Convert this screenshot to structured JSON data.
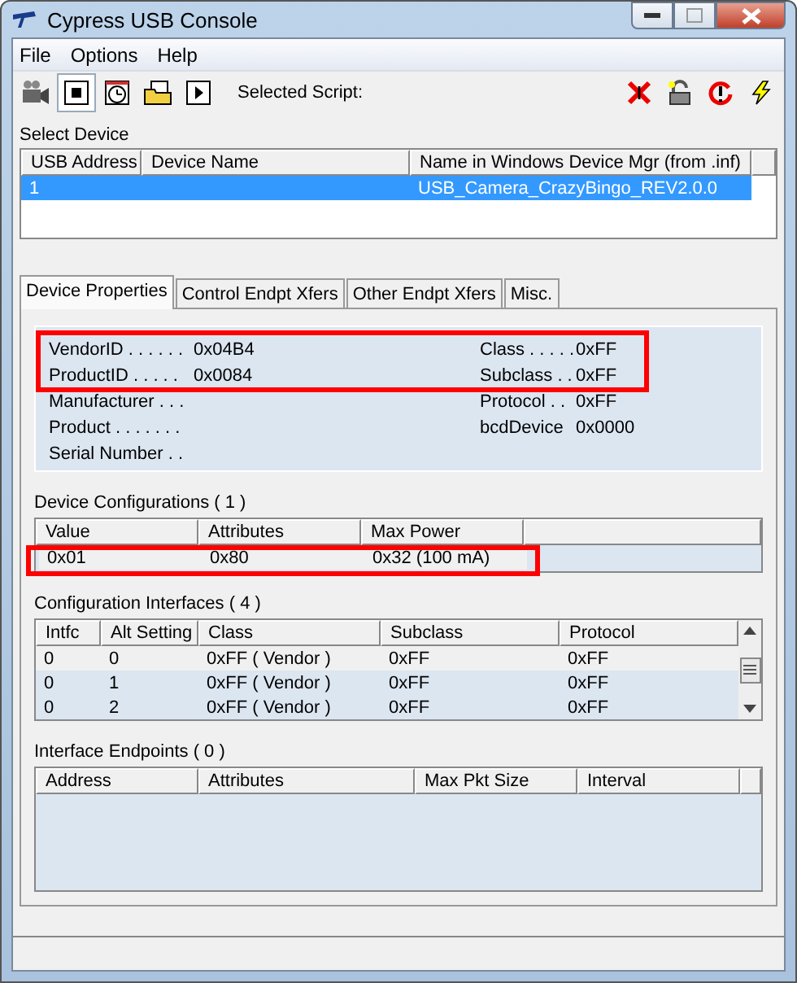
{
  "window": {
    "title": "Cypress USB Console"
  },
  "menu": [
    "File",
    "Options",
    "Help"
  ],
  "toolbar": {
    "left_tools": [
      {
        "kind": "camera",
        "pressed": false
      },
      {
        "kind": "stop",
        "pressed": true
      },
      {
        "kind": "timer",
        "pressed": false
      },
      {
        "kind": "folder",
        "pressed": false
      },
      {
        "kind": "play",
        "pressed": false
      }
    ],
    "selected_script_label": "Selected Script:",
    "right_tools": [
      {
        "kind": "cross"
      },
      {
        "kind": "lock"
      },
      {
        "kind": "reset"
      },
      {
        "kind": "bolt"
      }
    ]
  },
  "select_device": {
    "label": "Select Device",
    "columns": [
      "USB Address",
      "Device Name",
      "Name in Windows Device Mgr (from .inf)"
    ],
    "rows": [
      {
        "cells": [
          "1",
          "",
          "USB_Camera_CrazyBingo_REV2.0.0"
        ],
        "selected": true
      }
    ]
  },
  "tabs": [
    {
      "label": "Device Properties",
      "selected": true
    },
    {
      "label": "Control Endpt Xfers",
      "selected": false
    },
    {
      "label": "Other Endpt Xfers",
      "selected": false
    },
    {
      "label": "Misc.",
      "selected": false
    }
  ],
  "properties": {
    "annotated": true,
    "rows": [
      {
        "label": "VendorID . . . . . .",
        "value": "0x04B4",
        "right_label": "Class . . . . .",
        "right_value": "0xFF"
      },
      {
        "label": "ProductID  . . . . .",
        "value": "0x0084",
        "right_label": "Subclass . .",
        "right_value": "0xFF"
      },
      {
        "label": "Manufacturer . . .",
        "value": "",
        "right_label": "Protocol . .",
        "right_value": "0xFF"
      },
      {
        "label": "Product . . . . . . .",
        "value": "",
        "right_label": "bcdDevice",
        "right_value": "0x0000"
      },
      {
        "label": "Serial Number . .",
        "value": "",
        "right_label": "",
        "right_value": ""
      }
    ]
  },
  "device_configurations": {
    "label": "Device Configurations  ( 1 )",
    "annotated": true,
    "columns": [
      "Value",
      "Attributes",
      "Max Power"
    ],
    "rows": [
      [
        "0x01",
        "0x80",
        "0x32 (100 mA)"
      ]
    ]
  },
  "configuration_interfaces": {
    "label": "Configuration Interfaces  ( 4 )",
    "columns": [
      "Intfc",
      "Alt Setting",
      "Class",
      "Subclass",
      "Protocol"
    ],
    "rows": [
      [
        "0",
        "0",
        "0xFF ( Vendor )",
        "0xFF",
        "0xFF"
      ],
      [
        "0",
        "1",
        "0xFF ( Vendor )",
        "0xFF",
        "0xFF"
      ],
      [
        "0",
        "2",
        "0xFF ( Vendor )",
        "0xFF",
        "0xFF"
      ]
    ]
  },
  "interface_endpoints": {
    "label": "Interface Endpoints  ( 0 )",
    "columns": [
      "Address",
      "Attributes",
      "Max Pkt Size",
      "Interval"
    ]
  }
}
